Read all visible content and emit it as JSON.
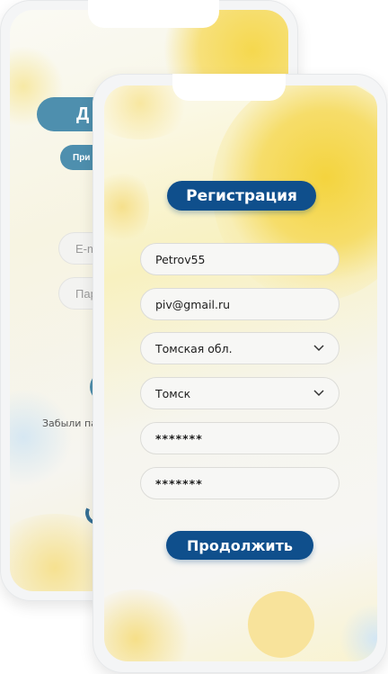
{
  "back_screen": {
    "title_partial": "Д",
    "sub_pill_partial": "При",
    "email_placeholder_partial": "E-m",
    "password_placeholder_partial": "Пар",
    "forgot_partial": "Забыли па"
  },
  "registration": {
    "title": "Регистрация",
    "fields": [
      {
        "value": "Petrov55",
        "type": "text"
      },
      {
        "value": "piv@gmail.ru",
        "type": "text"
      },
      {
        "value": "Томская обл.",
        "type": "select"
      },
      {
        "value": "Томск",
        "type": "select"
      },
      {
        "value": "*******",
        "type": "password"
      },
      {
        "value": "*******",
        "type": "password"
      }
    ],
    "continue_label": "Продолжить"
  },
  "colors": {
    "primary": "#0f4f8c",
    "secondary_pill": "#4e8fae",
    "accent_yellow": "#f6d64a"
  }
}
